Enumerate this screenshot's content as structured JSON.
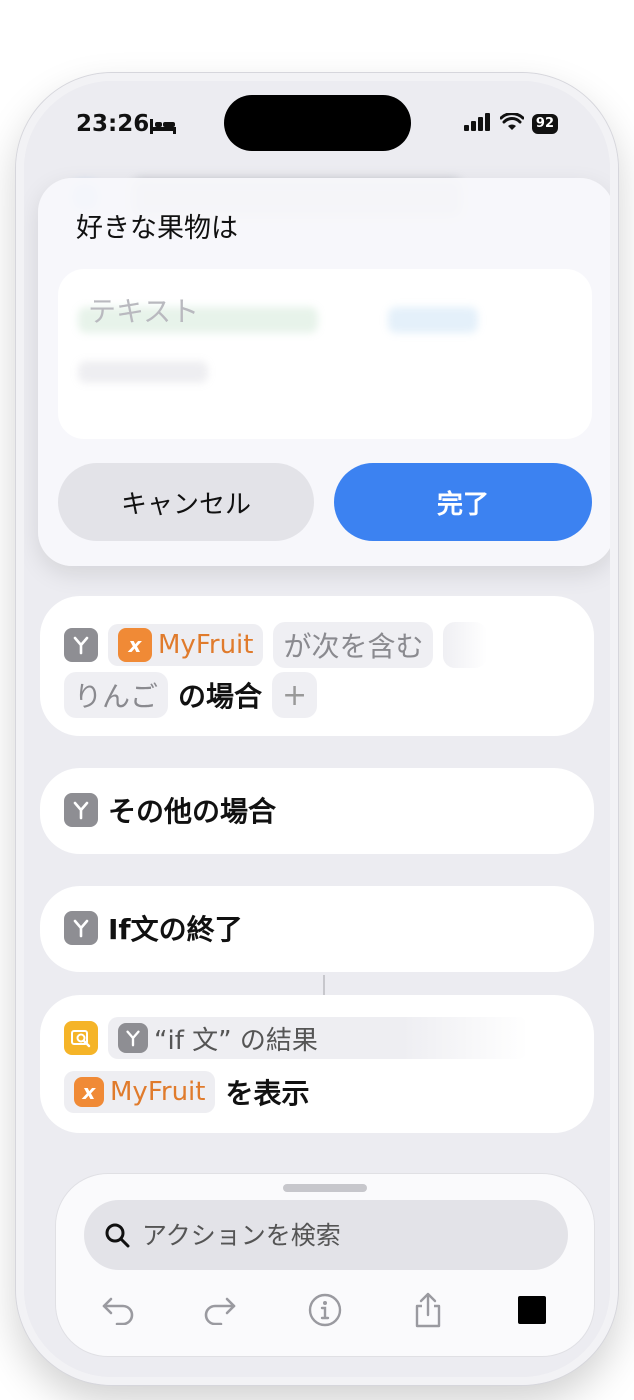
{
  "status": {
    "time": "23:26",
    "battery": "92"
  },
  "alert": {
    "title": "好きな果物は",
    "input_placeholder": "テキスト",
    "cancel_label": "キャンセル",
    "done_label": "完了"
  },
  "if_block": {
    "variable": "MyFruit",
    "condition": "が次を含む",
    "value": "りんご",
    "suffix": "の場合",
    "add": "+"
  },
  "else_block": {
    "label": "その他の場合"
  },
  "endif_block": {
    "label": "If文の終了"
  },
  "show_block": {
    "result_label": "“if 文” の結果",
    "variable": "MyFruit",
    "suffix": "を表示"
  },
  "toolbar": {
    "search_placeholder": "アクションを検索"
  },
  "colors": {
    "accent": "#3c82f1",
    "variable": "#f08a36",
    "action_icon": "#f5b428"
  },
  "icons": [
    "bed-icon",
    "cellular-icon",
    "wifi-icon",
    "branch-icon",
    "variable-icon",
    "quicklook-icon",
    "search-icon",
    "undo-icon",
    "redo-icon",
    "info-icon",
    "share-icon",
    "stop-icon"
  ]
}
